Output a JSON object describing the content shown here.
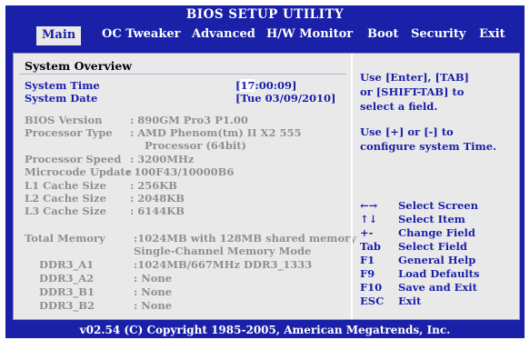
{
  "title": "BIOS SETUP UTILITY",
  "menu": [
    "Main",
    "OC Tweaker",
    "Advanced",
    "H/W Monitor",
    "Boot",
    "Security",
    "Exit"
  ],
  "overview_title": "System Overview",
  "system_time": {
    "label": "System Time",
    "cursor": "17",
    "rest": ":00:09]",
    "open": "["
  },
  "system_date": {
    "label": "System Date",
    "value": "[Tue 03/09/2010]"
  },
  "bios_version": {
    "label": "BIOS Version",
    "value": ": 890GM Pro3 P1.00"
  },
  "processor_type": {
    "label": "Processor Type",
    "value": ": AMD Phenom(tm) II X2 555",
    "value2": "Processor (64bit)"
  },
  "processor_speed": {
    "label": "Processor Speed",
    "value": ": 3200MHz"
  },
  "microcode": {
    "label": "Microcode Update",
    "value": ": 100F43/10000B6"
  },
  "l1": {
    "label": "L1 Cache Size",
    "value": ": 256KB"
  },
  "l2": {
    "label": "L2 Cache Size",
    "value": ": 2048KB"
  },
  "l3": {
    "label": "L3 Cache Size",
    "value": ": 6144KB"
  },
  "total_memory": {
    "label": "Total Memory",
    "value": ":1024MB with 128MB shared memory",
    "value2": "Single-Channel Memory Mode"
  },
  "ddr": [
    {
      "label": "DDR3_A1",
      "value": ":1024MB/667MHz DDR3_1333"
    },
    {
      "label": "DDR3_A2",
      "value": ": None"
    },
    {
      "label": "DDR3_B1",
      "value": ": None"
    },
    {
      "label": "DDR3_B2",
      "value": ": None"
    }
  ],
  "help": {
    "line1": "Use [Enter], [TAB]",
    "line2": "or [SHIFT-TAB] to",
    "line3": "select a field.",
    "line4": "Use [+] or [-] to",
    "line5": "configure system Time."
  },
  "keys": [
    {
      "key": "←→",
      "desc": "Select Screen"
    },
    {
      "key": "↑↓",
      "desc": "Select Item"
    },
    {
      "key": "+-",
      "desc": "Change Field"
    },
    {
      "key": "Tab",
      "desc": "Select Field"
    },
    {
      "key": "F1",
      "desc": "General Help"
    },
    {
      "key": "F9",
      "desc": "Load Defaults"
    },
    {
      "key": "F10",
      "desc": "Save and Exit"
    },
    {
      "key": "ESC",
      "desc": "Exit"
    }
  ],
  "footer": "v02.54 (C) Copyright 1985-2005, American Megatrends, Inc.",
  "colors": {
    "bios_blue": "#1a20a8",
    "panel_gray": "#e9e9e9",
    "label_gray": "#8f8f8f"
  }
}
